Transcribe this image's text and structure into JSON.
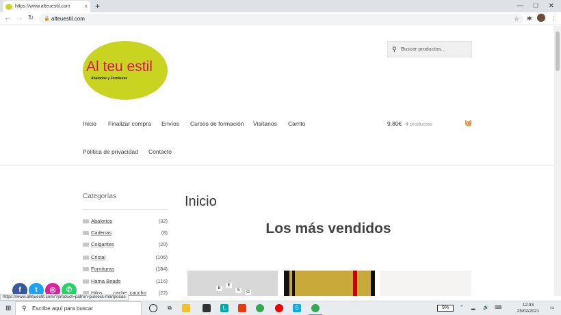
{
  "browser": {
    "tab_title": "https://www.alteuestil.com",
    "tab_close": "×",
    "new_tab": "+",
    "address": "alteuestil.com",
    "status_url": "https://www.alteuestil.com/?product=patron-pulsera-mariposas"
  },
  "site": {
    "logo_text": "Al teu estil",
    "logo_subtitle": "Abalorios y Fornituras",
    "search_placeholder": "Buscar productos…",
    "nav": [
      "Inicio",
      "Finalizar compra",
      "Envíos",
      "Cursos de formación",
      "Visítanos",
      "Carrito",
      "Política de privacidad",
      "Contacto"
    ],
    "cart_total": "9,80€",
    "cart_count": "4 productos"
  },
  "sidebar": {
    "title": "Categorías",
    "categories": [
      {
        "label": "Abalorios",
        "count": "(32)"
      },
      {
        "label": "Cadenas",
        "count": "(8)"
      },
      {
        "label": "Colgantes",
        "count": "(20)"
      },
      {
        "label": "Cristal",
        "count": "(106)"
      },
      {
        "label": "Fornituras",
        "count": "(184)"
      },
      {
        "label": "Hama Beads",
        "count": "(116)"
      },
      {
        "label": "Hilos, …, cache, caucho",
        "count": "(22)"
      }
    ]
  },
  "main": {
    "page_title": "Inicio",
    "section_title": "Los más vendidos"
  },
  "social": [
    {
      "name": "facebook",
      "glyph": "f",
      "color": "#3b5998"
    },
    {
      "name": "twitter",
      "glyph": "t",
      "color": "#1da1f2"
    },
    {
      "name": "instagram",
      "glyph": "◎",
      "color": "#d6249f"
    },
    {
      "name": "whatsapp",
      "glyph": "✆",
      "color": "#25d366"
    }
  ],
  "taskbar": {
    "search_placeholder": "Escribe aquí para buscar",
    "battery": "9%",
    "time": "12:33",
    "date": "25/02/2021"
  },
  "colors": {
    "logo_green": "#c8d41f",
    "logo_pink": "#d4145a"
  }
}
